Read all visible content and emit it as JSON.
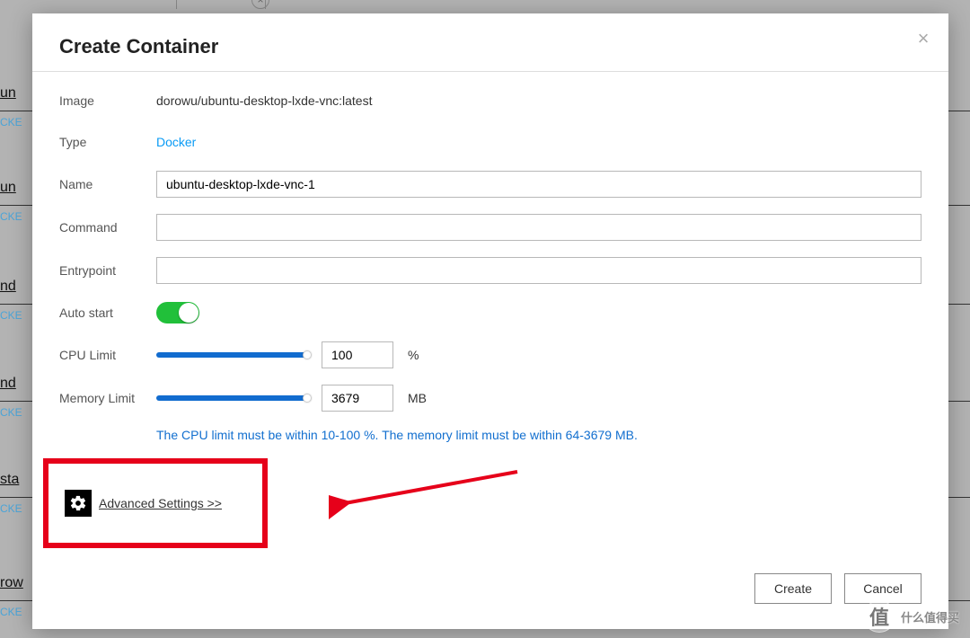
{
  "modal": {
    "title": "Create Container",
    "close_label": "×"
  },
  "form": {
    "image_label": "Image",
    "image_value": "dorowu/ubuntu-desktop-lxde-vnc:latest",
    "type_label": "Type",
    "type_value": "Docker",
    "name_label": "Name",
    "name_value": "ubuntu-desktop-lxde-vnc-1",
    "command_label": "Command",
    "command_value": "",
    "entrypoint_label": "Entrypoint",
    "entrypoint_value": "",
    "autostart_label": "Auto start",
    "autostart_on": true,
    "cpu_label": "CPU Limit",
    "cpu_value": "100",
    "cpu_unit": "%",
    "mem_label": "Memory Limit",
    "mem_value": "3679",
    "mem_unit": "MB",
    "hint": "The CPU limit must be within 10-100 %. The memory limit must be within 64-3679 MB."
  },
  "advanced": {
    "label": "Advanced Settings >>"
  },
  "footer": {
    "create": "Create",
    "cancel": "Cancel"
  },
  "watermark": "什么值得买",
  "bg": {
    "cke": "CKE",
    "un": "un",
    "nd": "nd",
    "sta": "sta",
    "row": "row"
  }
}
